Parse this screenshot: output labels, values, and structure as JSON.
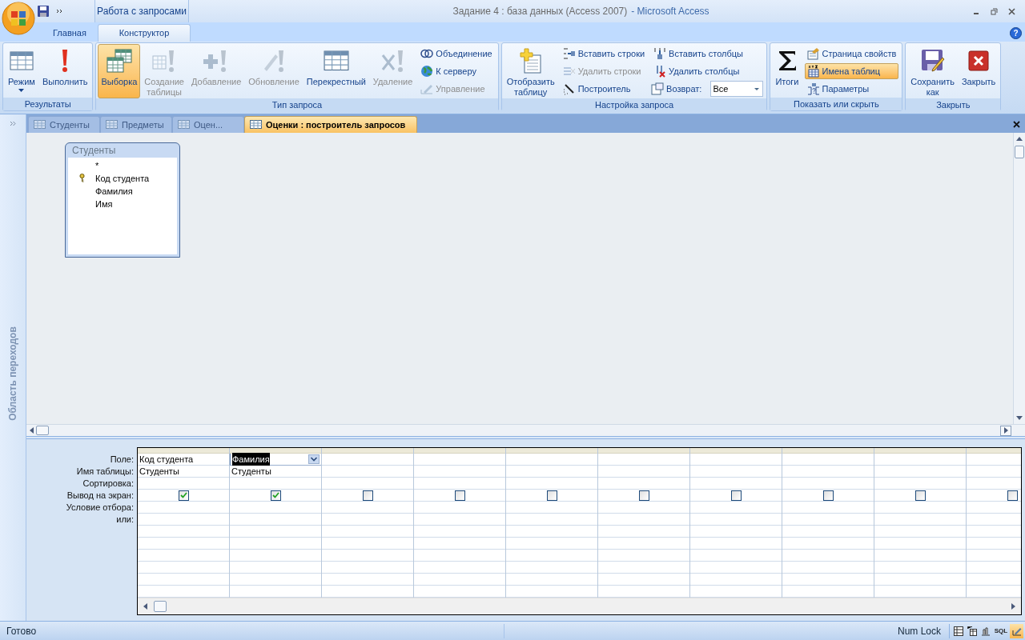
{
  "title_bar": {
    "context_tab": "Работа с запросами",
    "title": "Задание 4 : база данных (Access 2007)",
    "app": "- Microsoft Access"
  },
  "ribbon_tabs": [
    {
      "label": "Главная",
      "selected": false
    },
    {
      "label": "Конструктор",
      "selected": true
    }
  ],
  "help": "?",
  "ribbon_groups": [
    {
      "label": "Результаты",
      "items": [
        {
          "kind": "large",
          "label": "Режим",
          "disabled": false,
          "selected": false
        },
        {
          "kind": "large",
          "label": "Выполнить",
          "disabled": false,
          "selected": false
        }
      ]
    },
    {
      "label": "Тип запроса",
      "items": [
        {
          "kind": "large",
          "label": "Выборка",
          "disabled": false,
          "selected": true
        },
        {
          "kind": "large",
          "label": "Создание таблицы",
          "disabled": true,
          "selected": false
        },
        {
          "kind": "large",
          "label": "Добавление",
          "disabled": true,
          "selected": false
        },
        {
          "kind": "large",
          "label": "Обновление",
          "disabled": true,
          "selected": false
        },
        {
          "kind": "large",
          "label": "Перекрестный",
          "disabled": false,
          "selected": false
        },
        {
          "kind": "large",
          "label": "Удаление",
          "disabled": true,
          "selected": false
        },
        {
          "kind": "small",
          "label": "Объединение",
          "disabled": false,
          "selected": false
        },
        {
          "kind": "small",
          "label": "К серверу",
          "disabled": false,
          "selected": false
        },
        {
          "kind": "small",
          "label": "Управление",
          "disabled": true,
          "selected": false
        }
      ]
    },
    {
      "label": "Настройка запроса",
      "items": [
        {
          "kind": "large",
          "label": "Отобразить таблицу",
          "disabled": false,
          "selected": false
        },
        {
          "kind": "small",
          "label": "Вставить строки",
          "disabled": false,
          "selected": false
        },
        {
          "kind": "small",
          "label": "Удалить строки",
          "disabled": true,
          "selected": false
        },
        {
          "kind": "small",
          "label": "Построитель",
          "disabled": false,
          "selected": false
        },
        {
          "kind": "small",
          "label": "Вставить столбцы",
          "disabled": false,
          "selected": false
        },
        {
          "kind": "small",
          "label": "Удалить столбцы",
          "disabled": false,
          "selected": false
        },
        {
          "kind": "combo",
          "label": "Возврат:",
          "value": "Все"
        }
      ]
    },
    {
      "label": "Показать или скрыть",
      "items": [
        {
          "kind": "large",
          "label": "Итоги",
          "disabled": false,
          "selected": false
        },
        {
          "kind": "small",
          "label": "Страница свойств",
          "disabled": false,
          "selected": false
        },
        {
          "kind": "small",
          "label": "Имена таблиц",
          "disabled": false,
          "selected": true
        },
        {
          "kind": "small",
          "label": "Параметры",
          "disabled": false,
          "selected": false
        }
      ]
    },
    {
      "label": "Закрыть",
      "items": [
        {
          "kind": "large",
          "label": "Сохранить как",
          "disabled": false,
          "selected": false
        },
        {
          "kind": "large",
          "label": "Закрыть",
          "disabled": false,
          "selected": false
        }
      ]
    }
  ],
  "doc_tabs": [
    {
      "label": "Студенты",
      "selected": false
    },
    {
      "label": "Предметы",
      "selected": false
    },
    {
      "label": "Оцен...",
      "selected": false
    },
    {
      "label": "Оценки : построитель запросов",
      "selected": true
    }
  ],
  "nav_pane": {
    "label": "Область переходов"
  },
  "table_box": {
    "title": "Студенты",
    "fields": [
      {
        "name": "*",
        "key": false
      },
      {
        "name": "Код студента",
        "key": true
      },
      {
        "name": "Фамилия",
        "key": false
      },
      {
        "name": "Имя",
        "key": false
      }
    ]
  },
  "grid": {
    "row_labels": [
      "Поле:",
      "Имя таблицы:",
      "Сортировка:",
      "Вывод на экран:",
      "Условие отбора:",
      "или:"
    ],
    "columns": [
      {
        "field": "Код студента",
        "table": "Студенты",
        "show": true,
        "selected": false
      },
      {
        "field": "Фамилия",
        "table": "Студенты",
        "show": true,
        "selected": true
      },
      {
        "show": false,
        "selected": false
      },
      {
        "show": false,
        "selected": false
      },
      {
        "show": false,
        "selected": false
      },
      {
        "show": false,
        "selected": false
      },
      {
        "show": false,
        "selected": false
      },
      {
        "show": false,
        "selected": false
      },
      {
        "show": false,
        "selected": false
      },
      {
        "show": false,
        "selected": false
      }
    ]
  },
  "status_bar": {
    "text": "Готово",
    "num_lock": "Num Lock",
    "views": [
      {
        "kind": "datasheet",
        "selected": false
      },
      {
        "kind": "pivot_table",
        "selected": false
      },
      {
        "kind": "pivot_chart",
        "selected": false
      },
      {
        "kind": "sql",
        "label": "SQL",
        "selected": false
      },
      {
        "kind": "design",
        "selected": true
      }
    ]
  }
}
